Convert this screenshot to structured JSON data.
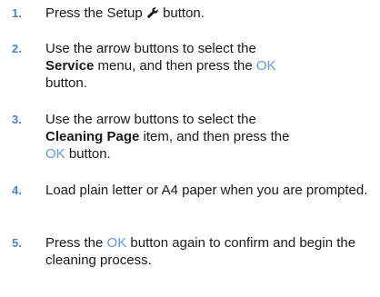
{
  "steps": [
    {
      "number": "1.",
      "before": "Press the Setup ",
      "icon": "wrench-icon",
      "after": " button."
    },
    {
      "number": "2.",
      "before": "Use the arrow buttons to select the ",
      "bold": "Service",
      "middle": " menu, and then press the ",
      "ok": "OK",
      "after": " button."
    },
    {
      "number": "3.",
      "before": "Use the arrow buttons to select the ",
      "bold": "Cleaning Page",
      "middle": " item, and then press the ",
      "ok": "OK",
      "after": " button."
    },
    {
      "number": "4.",
      "text": "Load plain letter or A4 paper when you are prompted."
    },
    {
      "number": "5.",
      "before": "Press the ",
      "ok": "OK",
      "after": " button again to confirm and begin the cleaning process."
    }
  ],
  "colors": {
    "number": "#4a86c5",
    "ok_text": "#5b9bd5",
    "body_text": "#1a1a1a"
  }
}
